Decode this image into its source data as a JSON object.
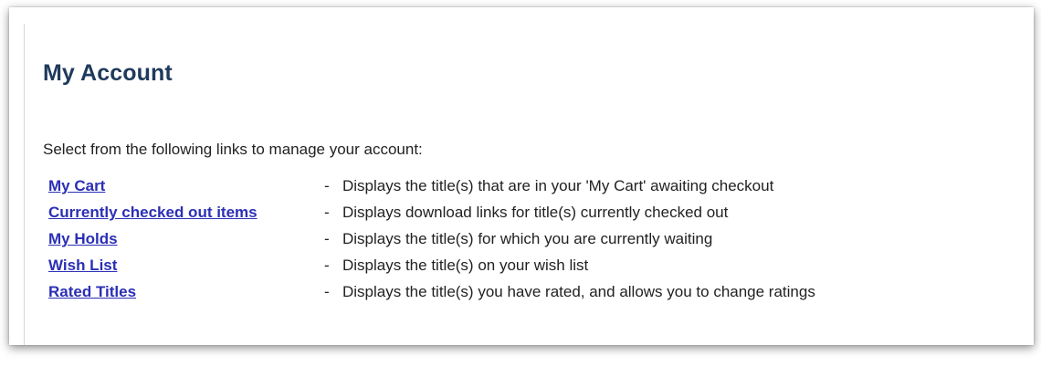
{
  "page": {
    "title": "My Account",
    "intro": "Select from the following links to manage your account:"
  },
  "links": [
    {
      "label": "My Cart",
      "separator": "-",
      "description": "Displays the title(s) that are in your 'My Cart' awaiting checkout"
    },
    {
      "label": "Currently checked out items",
      "separator": "-",
      "description": "Displays download links for title(s) currently checked out"
    },
    {
      "label": "My Holds",
      "separator": "-",
      "description": "Displays the title(s) for which you are currently waiting"
    },
    {
      "label": "Wish List",
      "separator": "-",
      "description": "Displays the title(s) on your wish list"
    },
    {
      "label": "Rated Titles",
      "separator": "-",
      "description": "Displays the title(s) you have rated, and allows you to change ratings"
    }
  ],
  "colors": {
    "title": "#1f3a5c",
    "link": "#2b2fb5",
    "text": "#222222"
  }
}
